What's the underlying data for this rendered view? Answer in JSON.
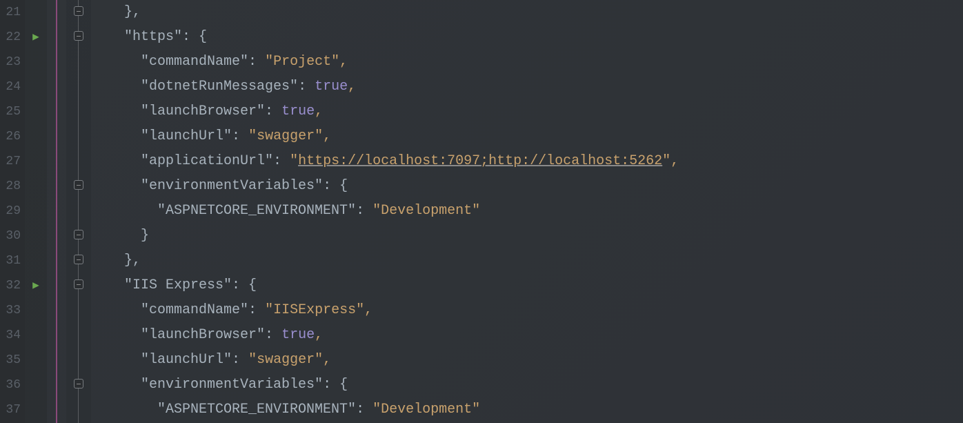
{
  "lines": {
    "21": "21",
    "22": "22",
    "23": "23",
    "24": "24",
    "25": "25",
    "26": "26",
    "27": "27",
    "28": "28",
    "29": "29",
    "30": "30",
    "31": "31",
    "32": "32",
    "33": "33",
    "34": "34",
    "35": "35",
    "36": "36",
    "37": "37"
  },
  "code": {
    "l21_brace": "},",
    "l22_key": "\"https\"",
    "l22_colon": ": {",
    "l23_key": "\"commandName\"",
    "l23_sep": ": ",
    "l23_val": "\"Project\"",
    "l23_comma": ",",
    "l24_key": "\"dotnetRunMessages\"",
    "l24_sep": ": ",
    "l24_val": "true",
    "l24_comma": ",",
    "l25_key": "\"launchBrowser\"",
    "l25_sep": ": ",
    "l25_val": "true",
    "l25_comma": ",",
    "l26_key": "\"launchUrl\"",
    "l26_sep": ": ",
    "l26_val": "\"swagger\"",
    "l26_comma": ",",
    "l27_key": "\"applicationUrl\"",
    "l27_sep": ": ",
    "l27_q1": "\"",
    "l27_url": "https://localhost:7097;http://localhost:5262",
    "l27_q2": "\"",
    "l27_comma": ",",
    "l28_key": "\"environmentVariables\"",
    "l28_sep": ": {",
    "l29_key": "\"ASPNETCORE_ENVIRONMENT\"",
    "l29_sep": ": ",
    "l29_val": "\"Development\"",
    "l30_brace": "}",
    "l31_brace": "},",
    "l32_key": "\"IIS Express\"",
    "l32_colon": ": {",
    "l33_key": "\"commandName\"",
    "l33_sep": ": ",
    "l33_val": "\"IISExpress\"",
    "l33_comma": ",",
    "l34_key": "\"launchBrowser\"",
    "l34_sep": ": ",
    "l34_val": "true",
    "l34_comma": ",",
    "l35_key": "\"launchUrl\"",
    "l35_sep": ": ",
    "l35_val": "\"swagger\"",
    "l35_comma": ",",
    "l36_key": "\"environmentVariables\"",
    "l36_sep": ": {",
    "l37_key": "\"ASPNETCORE_ENVIRONMENT\"",
    "l37_sep": ": ",
    "l37_val": "\"Development\""
  },
  "indent": {
    "i1": "    ",
    "i2": "      ",
    "i3": "        "
  }
}
